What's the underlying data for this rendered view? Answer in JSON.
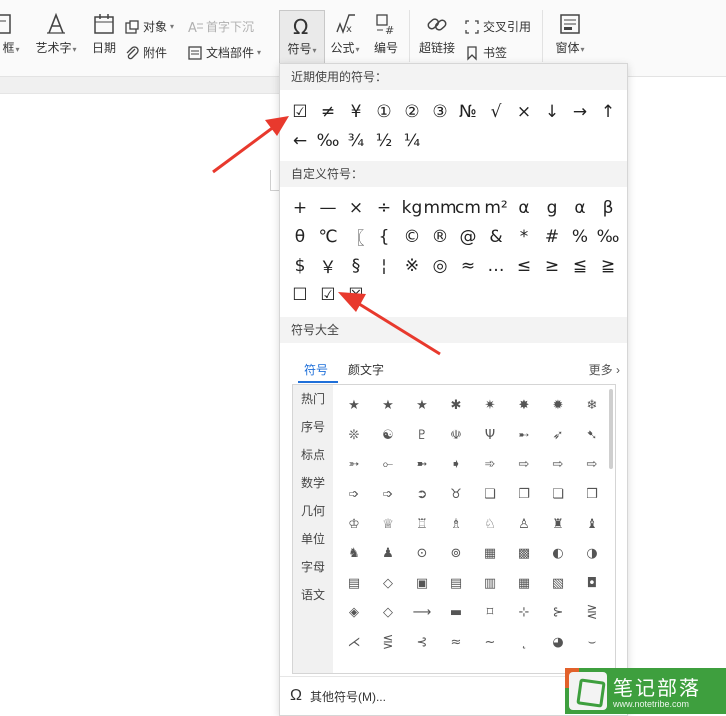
{
  "ribbon": {
    "textbox_label": "框",
    "wordart_label": "艺术字",
    "date_label": "日期",
    "object_label": "对象",
    "attachment_label": "附件",
    "dropcap_label": "首字下沉",
    "docparts_label": "文档部件",
    "symbol_label": "符号",
    "formula_label": "公式",
    "numbering_label": "编号",
    "hyperlink_label": "超链接",
    "crossref_label": "交叉引用",
    "bookmark_label": "书签",
    "window_label": "窗体"
  },
  "panel": {
    "recent_header": "近期使用的符号：",
    "recent_symbols": [
      "☑",
      "≠",
      "¥",
      "①",
      "②",
      "③",
      "№",
      "√",
      "×",
      "↓",
      "→",
      "↑",
      "←",
      "‰",
      "¾",
      "½",
      "¼"
    ],
    "custom_header": "自定义符号：",
    "custom_symbols": [
      "+",
      "—",
      "×",
      "÷",
      "kg",
      "mm",
      "cm",
      "m²",
      "α",
      "g",
      "α",
      "β",
      "θ",
      "℃",
      "〖",
      "{",
      "©",
      "®",
      "@",
      "&",
      "*",
      "#",
      "%",
      "‰",
      "$",
      "￥",
      "§",
      "¦",
      "※",
      "◎",
      "≈",
      "…",
      "≤",
      "≥",
      "≦",
      "≧",
      "☐",
      "☑",
      "☒"
    ],
    "library_header": "符号大全",
    "tab_symbols": "符号",
    "tab_kaomoji": "颜文字",
    "more_label": "更多",
    "categories": [
      "热门",
      "序号",
      "标点",
      "数学",
      "几何",
      "单位",
      "字母",
      "语文"
    ],
    "glyphs": [
      "★",
      "★",
      "★",
      "✱",
      "✷",
      "✸",
      "✹",
      "❄",
      "❊",
      "☯",
      "♇",
      "☫",
      "Ψ",
      "➸",
      "➶",
      "➷",
      "➳",
      "⟜",
      "➼",
      "➧",
      "➾",
      "⇨",
      "⇨",
      "⇨",
      "➩",
      "➩",
      "➲",
      "♉",
      "❑",
      "❐",
      "❏",
      "❒",
      "♔",
      "♕",
      "♖",
      "♗",
      "♘",
      "♙",
      "♜",
      "♝",
      "♞",
      "♟",
      "⊙",
      "⊚",
      "▦",
      "▩",
      "◐",
      "◑",
      "▤",
      "◇",
      "▣",
      "▤",
      "▥",
      "▦",
      "▧",
      "◘",
      "◈",
      "◇",
      "⟶",
      "▬",
      "⌑",
      "⊹",
      "⊱",
      "⋛",
      "⋌",
      "⋚",
      "⊰",
      "≈",
      "~",
      "˛",
      "◕",
      "⌣"
    ],
    "footer_label": "其他符号(M)..."
  },
  "watermark": {
    "title": "笔记部落",
    "url": "www.notetribe.com"
  },
  "colors": {
    "accent": "#1e6fd9",
    "arrow": "#e8392d",
    "watermark": "#3e9f3e"
  }
}
